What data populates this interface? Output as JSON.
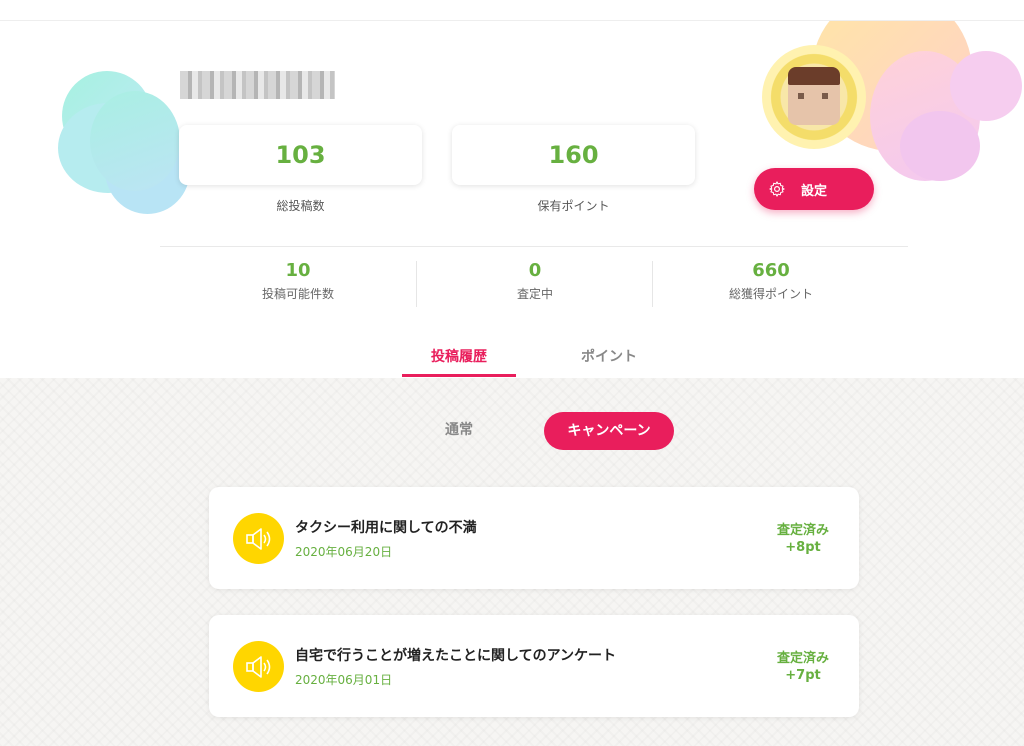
{
  "profile": {
    "username": "",
    "stats": {
      "total_posts_value": "103",
      "total_posts_label": "総投稿数",
      "held_points_value": "160",
      "held_points_label": "保有ポイント"
    },
    "settings_label": "設定",
    "sub_stats": [
      {
        "value": "10",
        "label": "投稿可能件数"
      },
      {
        "value": "0",
        "label": "査定中"
      },
      {
        "value": "660",
        "label": "総獲得ポイント"
      }
    ]
  },
  "tabs": [
    {
      "label": "投稿履歴",
      "active": true
    },
    {
      "label": "ポイント",
      "active": false
    }
  ],
  "segments": {
    "normal_label": "通常",
    "campaign_label": "キャンペーン",
    "selected": "campaign"
  },
  "posts": [
    {
      "title": "タクシー利用に関しての不満",
      "date": "2020年06月20日",
      "status": "査定済み",
      "points": "+8pt",
      "icon": "megaphone-icon"
    },
    {
      "title": "自宅で行うことが増えたことに関してのアンケート",
      "date": "2020年06月01日",
      "status": "査定済み",
      "points": "+7pt",
      "icon": "megaphone-icon"
    }
  ],
  "colors": {
    "accent": "#e91e5c",
    "green": "#67b040",
    "icon_yellow": "#ffd600"
  }
}
